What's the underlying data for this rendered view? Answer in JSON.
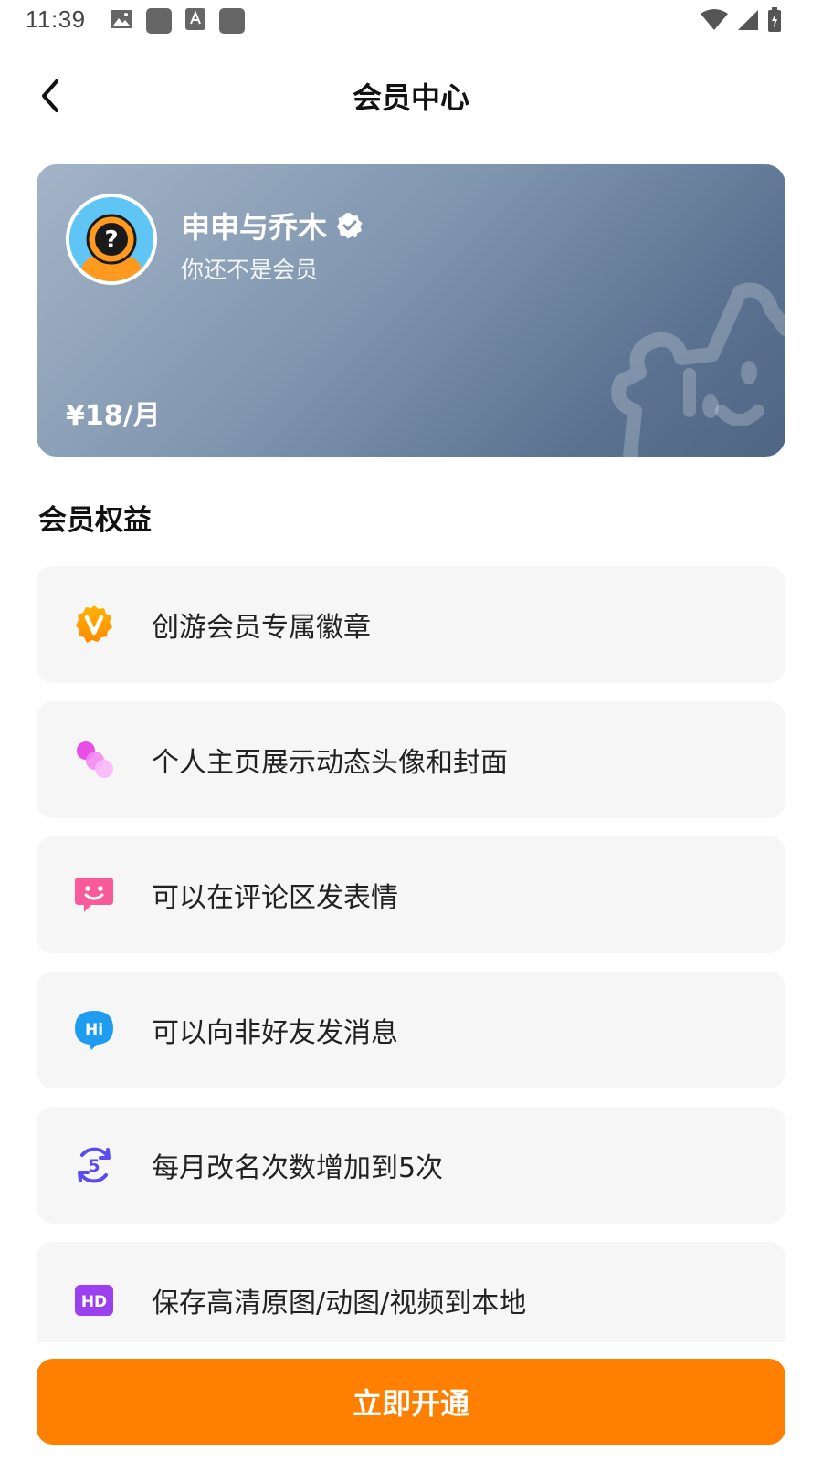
{
  "status_bar": {
    "time": "11:39",
    "icons": [
      "image-icon",
      "app-icon",
      "text-icon",
      "app-icon",
      "wifi-icon",
      "signal-icon",
      "battery-icon"
    ]
  },
  "header": {
    "title": "会员中心",
    "back_icon": "chevron-left-icon"
  },
  "member_card": {
    "username": "申申与乔木",
    "verified_icon": "verified-badge-icon",
    "status": "你还不是会员",
    "price": "¥18/月",
    "colors": {
      "gradient_start": "#a3b4c8",
      "gradient_end": "#4f6785"
    }
  },
  "benefits": {
    "title": "会员权益",
    "items": [
      {
        "label": "创游会员专属徽章",
        "icon": "v-badge-icon",
        "color": "#f7a400"
      },
      {
        "label": "个人主页展示动态头像和封面",
        "icon": "bubbles-icon",
        "color": "#e84de8"
      },
      {
        "label": "可以在评论区发表情",
        "icon": "emoji-chat-icon",
        "color": "#f85a9a"
      },
      {
        "label": "可以向非好友发消息",
        "icon": "hi-chat-icon",
        "color": "#1e9df0"
      },
      {
        "label": "每月改名次数增加到5次",
        "icon": "refresh-five-icon",
        "color": "#5a4cf0"
      },
      {
        "label": "保存高清原图/动图/视频到本地",
        "icon": "hd-icon",
        "color": "#9a40ee"
      }
    ]
  },
  "cta": {
    "label": "立即开通",
    "color": "#ff8000"
  }
}
